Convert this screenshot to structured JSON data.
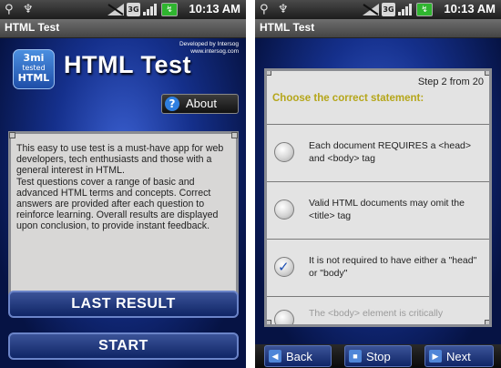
{
  "status_bar": {
    "time": "10:13 AM",
    "network_label": "3G"
  },
  "left_screen": {
    "title": "HTML Test",
    "developer_line1": "Developed by Intersog",
    "developer_line2": "www.intersog.com",
    "logo_top": "3mi",
    "logo_mid": "tested",
    "logo_bottom": "HTML",
    "app_title": "HTML Test",
    "about_label": "About",
    "description": "This easy to use test is a must-have app for web developers, tech enthusiasts and those with a general interest in HTML.\nTest questions cover a range of basic and advanced HTML terms and concepts. Correct answers are provided after each question to reinforce learning. Overall results are displayed upon conclusion, to provide instant feedback.",
    "last_result_label": "LAST RESULT",
    "start_label": "START"
  },
  "right_screen": {
    "title": "HTML Test",
    "step_text": "Step 2 from 20",
    "question": "Choose the correct statement:",
    "options": [
      {
        "text": "Each document REQUIRES a <head> and <body> tag",
        "selected": false
      },
      {
        "text": "Valid HTML documents may omit the <title> tag",
        "selected": false
      },
      {
        "text": "It is not required to have either a \"head\" or \"body\"",
        "selected": true
      },
      {
        "text": "The <body> element is critically",
        "selected": false
      }
    ],
    "nav": {
      "back_label": "Back",
      "stop_label": "Stop",
      "next_label": "Next"
    }
  },
  "colors": {
    "accent_question": "#b5a61a",
    "panel_bg": "#d8d7d6",
    "button_blue": "#2a4590"
  },
  "icons": [
    "usb-icon",
    "signal-icon",
    "battery-icon",
    "question-icon",
    "radio-icon",
    "check-icon",
    "back-arrow-icon",
    "stop-icon",
    "next-arrow-icon"
  ]
}
